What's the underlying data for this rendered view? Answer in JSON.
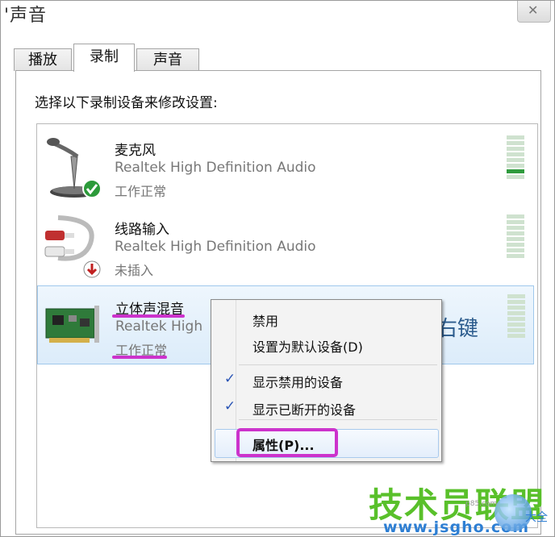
{
  "window": {
    "title": "'声音",
    "close_label": "✕"
  },
  "tabs": [
    {
      "label": "播放",
      "active": false
    },
    {
      "label": "录制",
      "active": true
    },
    {
      "label": "声音",
      "active": false
    }
  ],
  "instruction": "选择以下录制设备来修改设置:",
  "devices": [
    {
      "name": "麦克风",
      "driver": "Realtek High Definition Audio",
      "status": "工作正常",
      "icon": "microphone-icon",
      "badge": "green-check",
      "meter_level": 0.2
    },
    {
      "name": "线路输入",
      "driver": "Realtek High Definition Audio",
      "status": "未插入",
      "icon": "line-in-cable-icon",
      "badge": "red-down-arrow",
      "meter_level": 0
    },
    {
      "name": "立体声混音",
      "driver": "Realtek High",
      "status": "工作正常",
      "icon": "sound-card-icon",
      "badge": "none",
      "meter_level": 0,
      "selected": true
    }
  ],
  "annotation": {
    "right_click_hint": "右键",
    "highlight_color": "#cc33cc"
  },
  "context_menu": {
    "items": [
      {
        "label": "禁用",
        "checked": false
      },
      {
        "label": "设置为默认设备(D)",
        "checked": false
      },
      {
        "label": "显示禁用的设备",
        "checked": true
      },
      {
        "label": "显示已断开的设备",
        "checked": true
      },
      {
        "label": "属性(P)...",
        "checked": false,
        "hovered": true
      }
    ],
    "check_glyph": "✓"
  },
  "watermark": {
    "brand": "技术员联盟",
    "url": "www.jsgho.com",
    "small": "大全",
    "tiny": "p85.com"
  },
  "colors": {
    "meter_on": "#2f9b3d",
    "meter_off": "#cfe2cf",
    "selection": "#dcecfa",
    "highlight": "#cc33cc",
    "watermark_green": "#59c02a"
  }
}
